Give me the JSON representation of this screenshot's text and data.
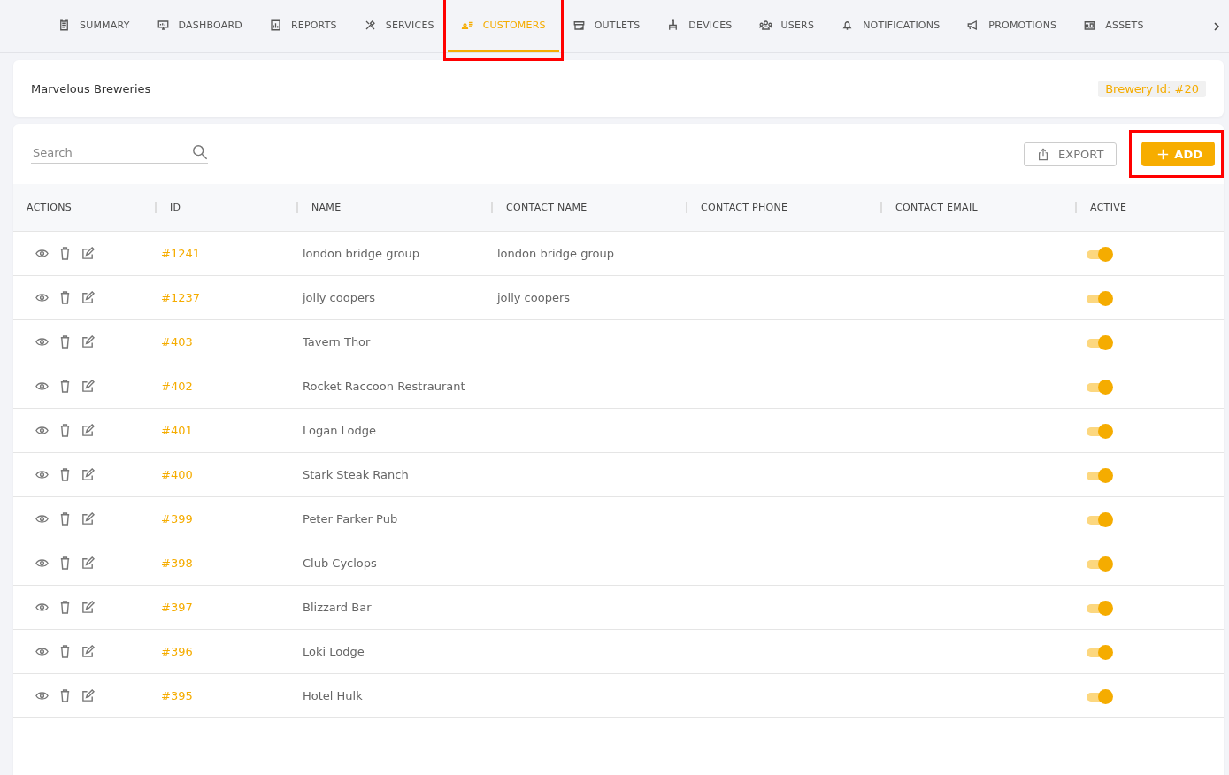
{
  "tabs": [
    {
      "label": "SUMMARY",
      "selected": false,
      "highlighted": false
    },
    {
      "label": "DASHBOARD",
      "selected": false,
      "highlighted": false
    },
    {
      "label": "REPORTS",
      "selected": false,
      "highlighted": false
    },
    {
      "label": "SERVICES",
      "selected": false,
      "highlighted": false
    },
    {
      "label": "CUSTOMERS",
      "selected": true,
      "highlighted": true
    },
    {
      "label": "OUTLETS",
      "selected": false,
      "highlighted": false
    },
    {
      "label": "DEVICES",
      "selected": false,
      "highlighted": false
    },
    {
      "label": "USERS",
      "selected": false,
      "highlighted": false
    },
    {
      "label": "NOTIFICATIONS",
      "selected": false,
      "highlighted": false
    },
    {
      "label": "PROMOTIONS",
      "selected": false,
      "highlighted": false
    },
    {
      "label": "ASSETS",
      "selected": false,
      "highlighted": false
    }
  ],
  "header": {
    "title": "Marvelous Breweries",
    "badge": "Brewery Id: #20"
  },
  "toolbar": {
    "search": {
      "placeholder": "Search"
    },
    "export_button": "EXPORT",
    "add_button": {
      "label": "ADD",
      "highlighted": true
    }
  },
  "table": {
    "columns": [
      "ACTIONS",
      "ID",
      "NAME",
      "CONTACT NAME",
      "CONTACT PHONE",
      "CONTACT EMAIL",
      "ACTIVE"
    ],
    "rows": [
      {
        "id": "#1241",
        "name": "london bridge group",
        "contact_name": "london bridge group",
        "active": true
      },
      {
        "id": "#1237",
        "name": "jolly coopers",
        "contact_name": "jolly coopers",
        "active": true
      },
      {
        "id": "#403",
        "name": "Tavern Thor",
        "active": true
      },
      {
        "id": "#402",
        "name": "Rocket Raccoon Restraurant",
        "active": true
      },
      {
        "id": "#401",
        "name": "Logan Lodge",
        "active": true
      },
      {
        "id": "#400",
        "name": "Stark Steak Ranch",
        "active": true
      },
      {
        "id": "#399",
        "name": "Peter Parker Pub",
        "active": true
      },
      {
        "id": "#398",
        "name": "Club Cyclops",
        "active": true
      },
      {
        "id": "#397",
        "name": "Blizzard Bar",
        "active": true
      },
      {
        "id": "#396",
        "name": "Loki Lodge",
        "active": true
      },
      {
        "id": "#395",
        "name": "Hotel Hulk",
        "active": true
      }
    ]
  }
}
